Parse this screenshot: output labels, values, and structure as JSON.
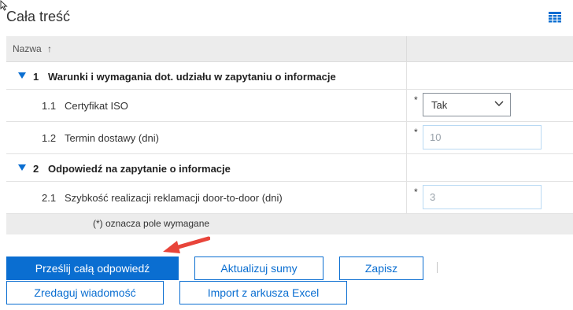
{
  "page": {
    "title": "Cała treść"
  },
  "table": {
    "header": {
      "name_col": "Nazwa",
      "sort_symbol": "↑"
    },
    "sections": [
      {
        "number": "1",
        "label": "Warunki i wymagania dot. udziału w zapytaniu o informacje",
        "items": [
          {
            "number": "1.1",
            "label": "Certyfikat ISO",
            "required": "*",
            "control": "select",
            "value": "Tak"
          },
          {
            "number": "1.2",
            "label": "Termin dostawy (dni)",
            "required": "*",
            "control": "input",
            "value": "10"
          }
        ]
      },
      {
        "number": "2",
        "label": "Odpowiedź na zapytanie o informacje",
        "items": [
          {
            "number": "2.1",
            "label": "Szybkość realizacji reklamacji door-to-door (dni)",
            "required": "*",
            "control": "input",
            "value": "3"
          }
        ]
      }
    ],
    "footer_note": "(*) oznacza pole wymagane"
  },
  "buttons": {
    "submit_all": "Prześlij całą odpowiedź",
    "update_totals": "Aktualizuj sumy",
    "save": "Zapisz",
    "edit_message": "Zredaguj wiadomość",
    "import_excel": "Import z arkusza Excel"
  },
  "colors": {
    "accent": "#0a6ed1",
    "annotation_arrow": "#e8443a",
    "header_bg": "#ececec"
  },
  "icons": {
    "grid": "table-grid-icon",
    "sort": "sort-ascending-icon",
    "expand": "collapse-triangle-icon",
    "dropdown": "chevron-down-icon",
    "annotation": "red-arrow-icon",
    "cursor": "mouse-cursor-icon"
  }
}
